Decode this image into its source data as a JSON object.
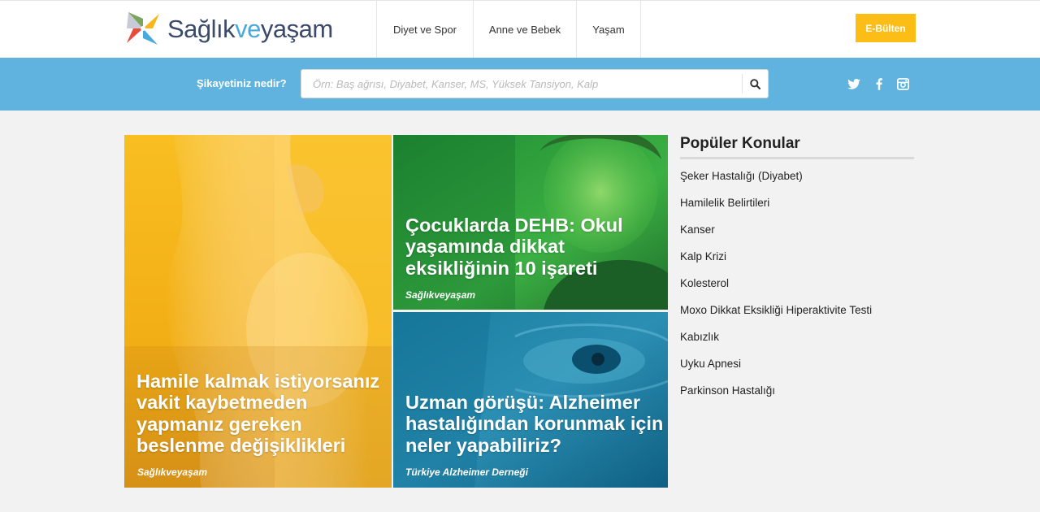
{
  "brand": {
    "name_part1": "Sağlık",
    "name_part2": "ve",
    "name_part3": "yaşam"
  },
  "nav": {
    "items": [
      {
        "label": "Diyet ve Spor"
      },
      {
        "label": "Anne ve Bebek"
      },
      {
        "label": "Yaşam"
      }
    ],
    "ebulten_label": "E-Bülten"
  },
  "search": {
    "label": "Şikayetiniz nedir?",
    "placeholder": "Örn: Baş ağrısı, Diyabet, Kanser, MS, Yüksek Tansiyon, Kalp",
    "value": "",
    "button_icon": "search-icon"
  },
  "social": [
    {
      "icon": "twitter-icon"
    },
    {
      "icon": "facebook-icon"
    },
    {
      "icon": "instagram-icon"
    }
  ],
  "articles": [
    {
      "title": "Hamile kalmak istiyorsanız vakit kaybetmeden yapmanız gereken beslenme değişiklikleri",
      "source": "Sağlıkveyaşam",
      "overlay_color": "#f5b41a"
    },
    {
      "title": "Çocuklarda DEHB: Okul yaşamında dikkat eksikliğinin 10 işareti",
      "source": "Sağlıkveyaşam",
      "overlay_color": "#2ea33a"
    },
    {
      "title": "Uzman görüşü: Alzheimer hastalığından korunmak için neler yapabiliriz?",
      "source": "Türkiye Alzheimer Derneği",
      "overlay_color": "#0f7ea8"
    }
  ],
  "sidebar": {
    "title": "Popüler Konular",
    "items": [
      {
        "label": "Şeker Hastalığı (Diyabet)"
      },
      {
        "label": "Hamilelik Belirtileri"
      },
      {
        "label": "Kanser"
      },
      {
        "label": "Kalp Krizi"
      },
      {
        "label": "Kolesterol"
      },
      {
        "label": "Moxo Dikkat Eksikliği Hiperaktivite Testi"
      },
      {
        "label": "Kabızlık"
      },
      {
        "label": "Uyku Apnesi"
      },
      {
        "label": "Parkinson Hastalığı"
      }
    ]
  },
  "colors": {
    "header_bg": "#ffffff",
    "searchbar_bg": "#5fb3de",
    "ebulten_bg": "#fbbd16",
    "page_bg": "#f2f2f2",
    "brand_dark": "#3b4a6b",
    "brand_blue": "#4aa9dc"
  }
}
